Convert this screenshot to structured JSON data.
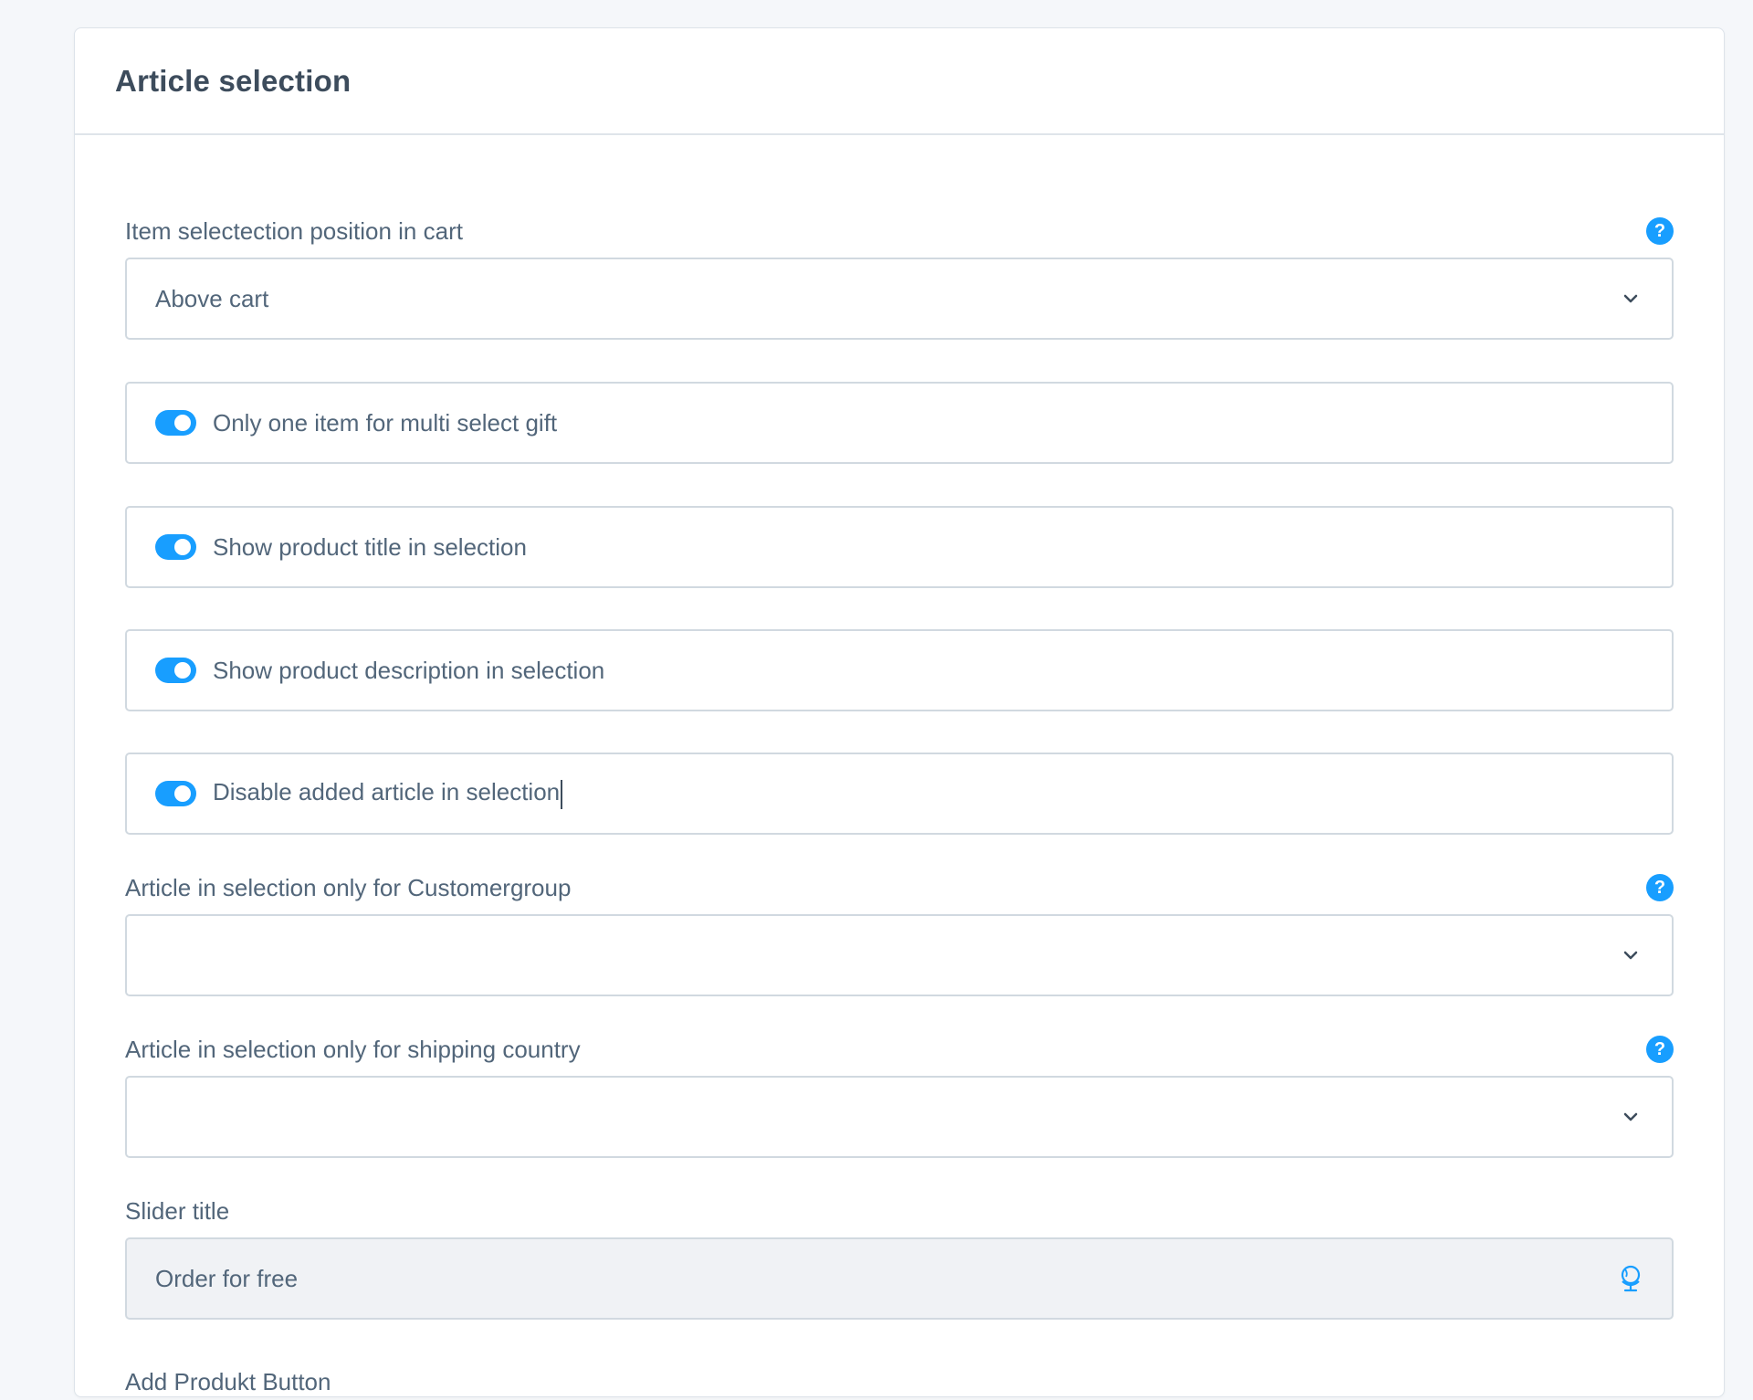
{
  "card": {
    "title": "Article selection"
  },
  "position_field": {
    "label": "Item selectection position in cart",
    "value": "Above cart"
  },
  "switches": [
    {
      "label": "Only one item for multi select gift",
      "enabled": true
    },
    {
      "label": "Show product title in selection",
      "enabled": true
    },
    {
      "label": "Show product description in selection",
      "enabled": true
    },
    {
      "label": "Disable added article in selection",
      "enabled": true
    }
  ],
  "customergroup_field": {
    "label": "Article in selection only for Customergroup",
    "value": ""
  },
  "country_field": {
    "label": "Article in selection only for shipping country",
    "value": ""
  },
  "slider_title_field": {
    "label": "Slider title",
    "value": "Order for free"
  },
  "add_button_field": {
    "label": "Add Produkt Button"
  },
  "colors": {
    "accent": "#189eff",
    "text": "#52667a",
    "border": "#d1d9e0"
  },
  "icons": {
    "help": "help-icon",
    "chevron": "chevron-down-icon",
    "translation": "globe-icon"
  }
}
